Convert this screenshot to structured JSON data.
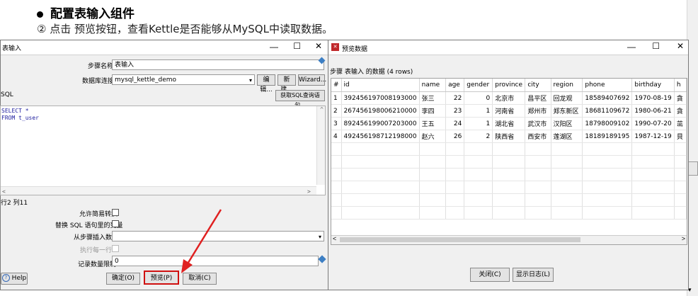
{
  "slide": {
    "bullet_title": "配置表输入组件",
    "subline": "② 点击 预览按钮，查看Kettle是否能够从MySQL中读取数据。"
  },
  "left_dialog": {
    "title": "表输入",
    "step_name_label": "步骤名称",
    "step_name_value": "表输入",
    "db_conn_label": "数据库连接",
    "db_conn_value": "mysql_kettle_demo",
    "edit_btn": "编辑...",
    "new_btn": "新建...",
    "wizard_btn": "Wizard...",
    "sql_label": "SQL",
    "get_sql_btn": "获取SQL查询语句...",
    "sql_line1": "SELECT *",
    "sql_line2": "FROM t_user",
    "row_col_status": "行2 列11",
    "lazy_conv_label": "允许简易转换",
    "replace_vars_label": "替换 SQL 语句里的变量",
    "insert_from_step_label": "从步骤插入数据",
    "exec_each_row_label": "执行每一行?",
    "limit_label": "记录数量限制",
    "limit_value": "0",
    "help_btn": "Help",
    "ok_btn": "确定(O)",
    "preview_btn": "预览(P)",
    "cancel_btn": "取消(C)"
  },
  "right_dialog": {
    "title": "预览数据",
    "caption": "步骤 表输入 的数据 (4 rows)",
    "close_btn": "关闭(C)",
    "show_log_btn": "显示日志(L)",
    "columns": [
      "#",
      "id",
      "name",
      "age",
      "gender",
      "province",
      "city",
      "region",
      "phone",
      "birthday",
      "h"
    ],
    "rows": [
      [
        "1",
        "392456197008193000",
        "张三",
        "22",
        "0",
        "北京市",
        "昌平区",
        "回龙观",
        "18589407692",
        "1970-08-19",
        "貪"
      ],
      [
        "2",
        "267456198006210000",
        "李四",
        "23",
        "1",
        "河南省",
        "郑州市",
        "郑东新区",
        "18681109672",
        "1980-06-21",
        "貪"
      ],
      [
        "3",
        "892456199007203000",
        "王五",
        "24",
        "1",
        "湖北省",
        "武汉市",
        "汉阳区",
        "18798009102",
        "1990-07-20",
        "茁"
      ],
      [
        "4",
        "492456198712198000",
        "赵六",
        "26",
        "2",
        "陕西省",
        "西安市",
        "莲湖区",
        "18189189195",
        "1987-12-19",
        "貝"
      ]
    ]
  },
  "window_controls": [
    "—",
    "☐",
    "✕"
  ],
  "colors": {
    "arrow": "#e02020",
    "highlight": "#d01010",
    "sql_text": "#1d1d9e"
  }
}
